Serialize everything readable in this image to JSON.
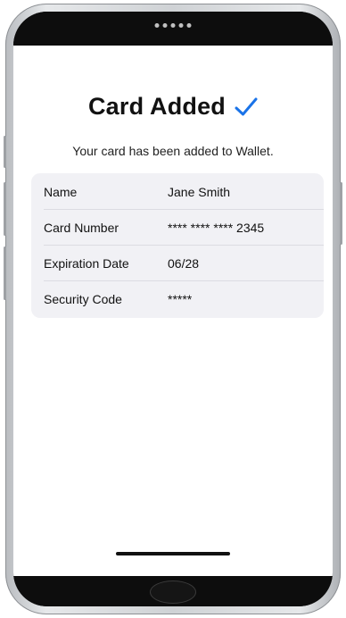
{
  "screen": {
    "title": "Card Added",
    "subtitle": "Your card has been added to Wallet.",
    "accent_color": "#1a73e8"
  },
  "card_details": {
    "rows": [
      {
        "label": "Name",
        "value": "Jane Smith"
      },
      {
        "label": "Card Number",
        "value": "**** **** **** 2345"
      },
      {
        "label": "Expiration Date",
        "value": "06/28"
      },
      {
        "label": "Security Code",
        "value": "*****"
      }
    ]
  },
  "icons": {
    "title_icon": "checkmark-icon"
  }
}
